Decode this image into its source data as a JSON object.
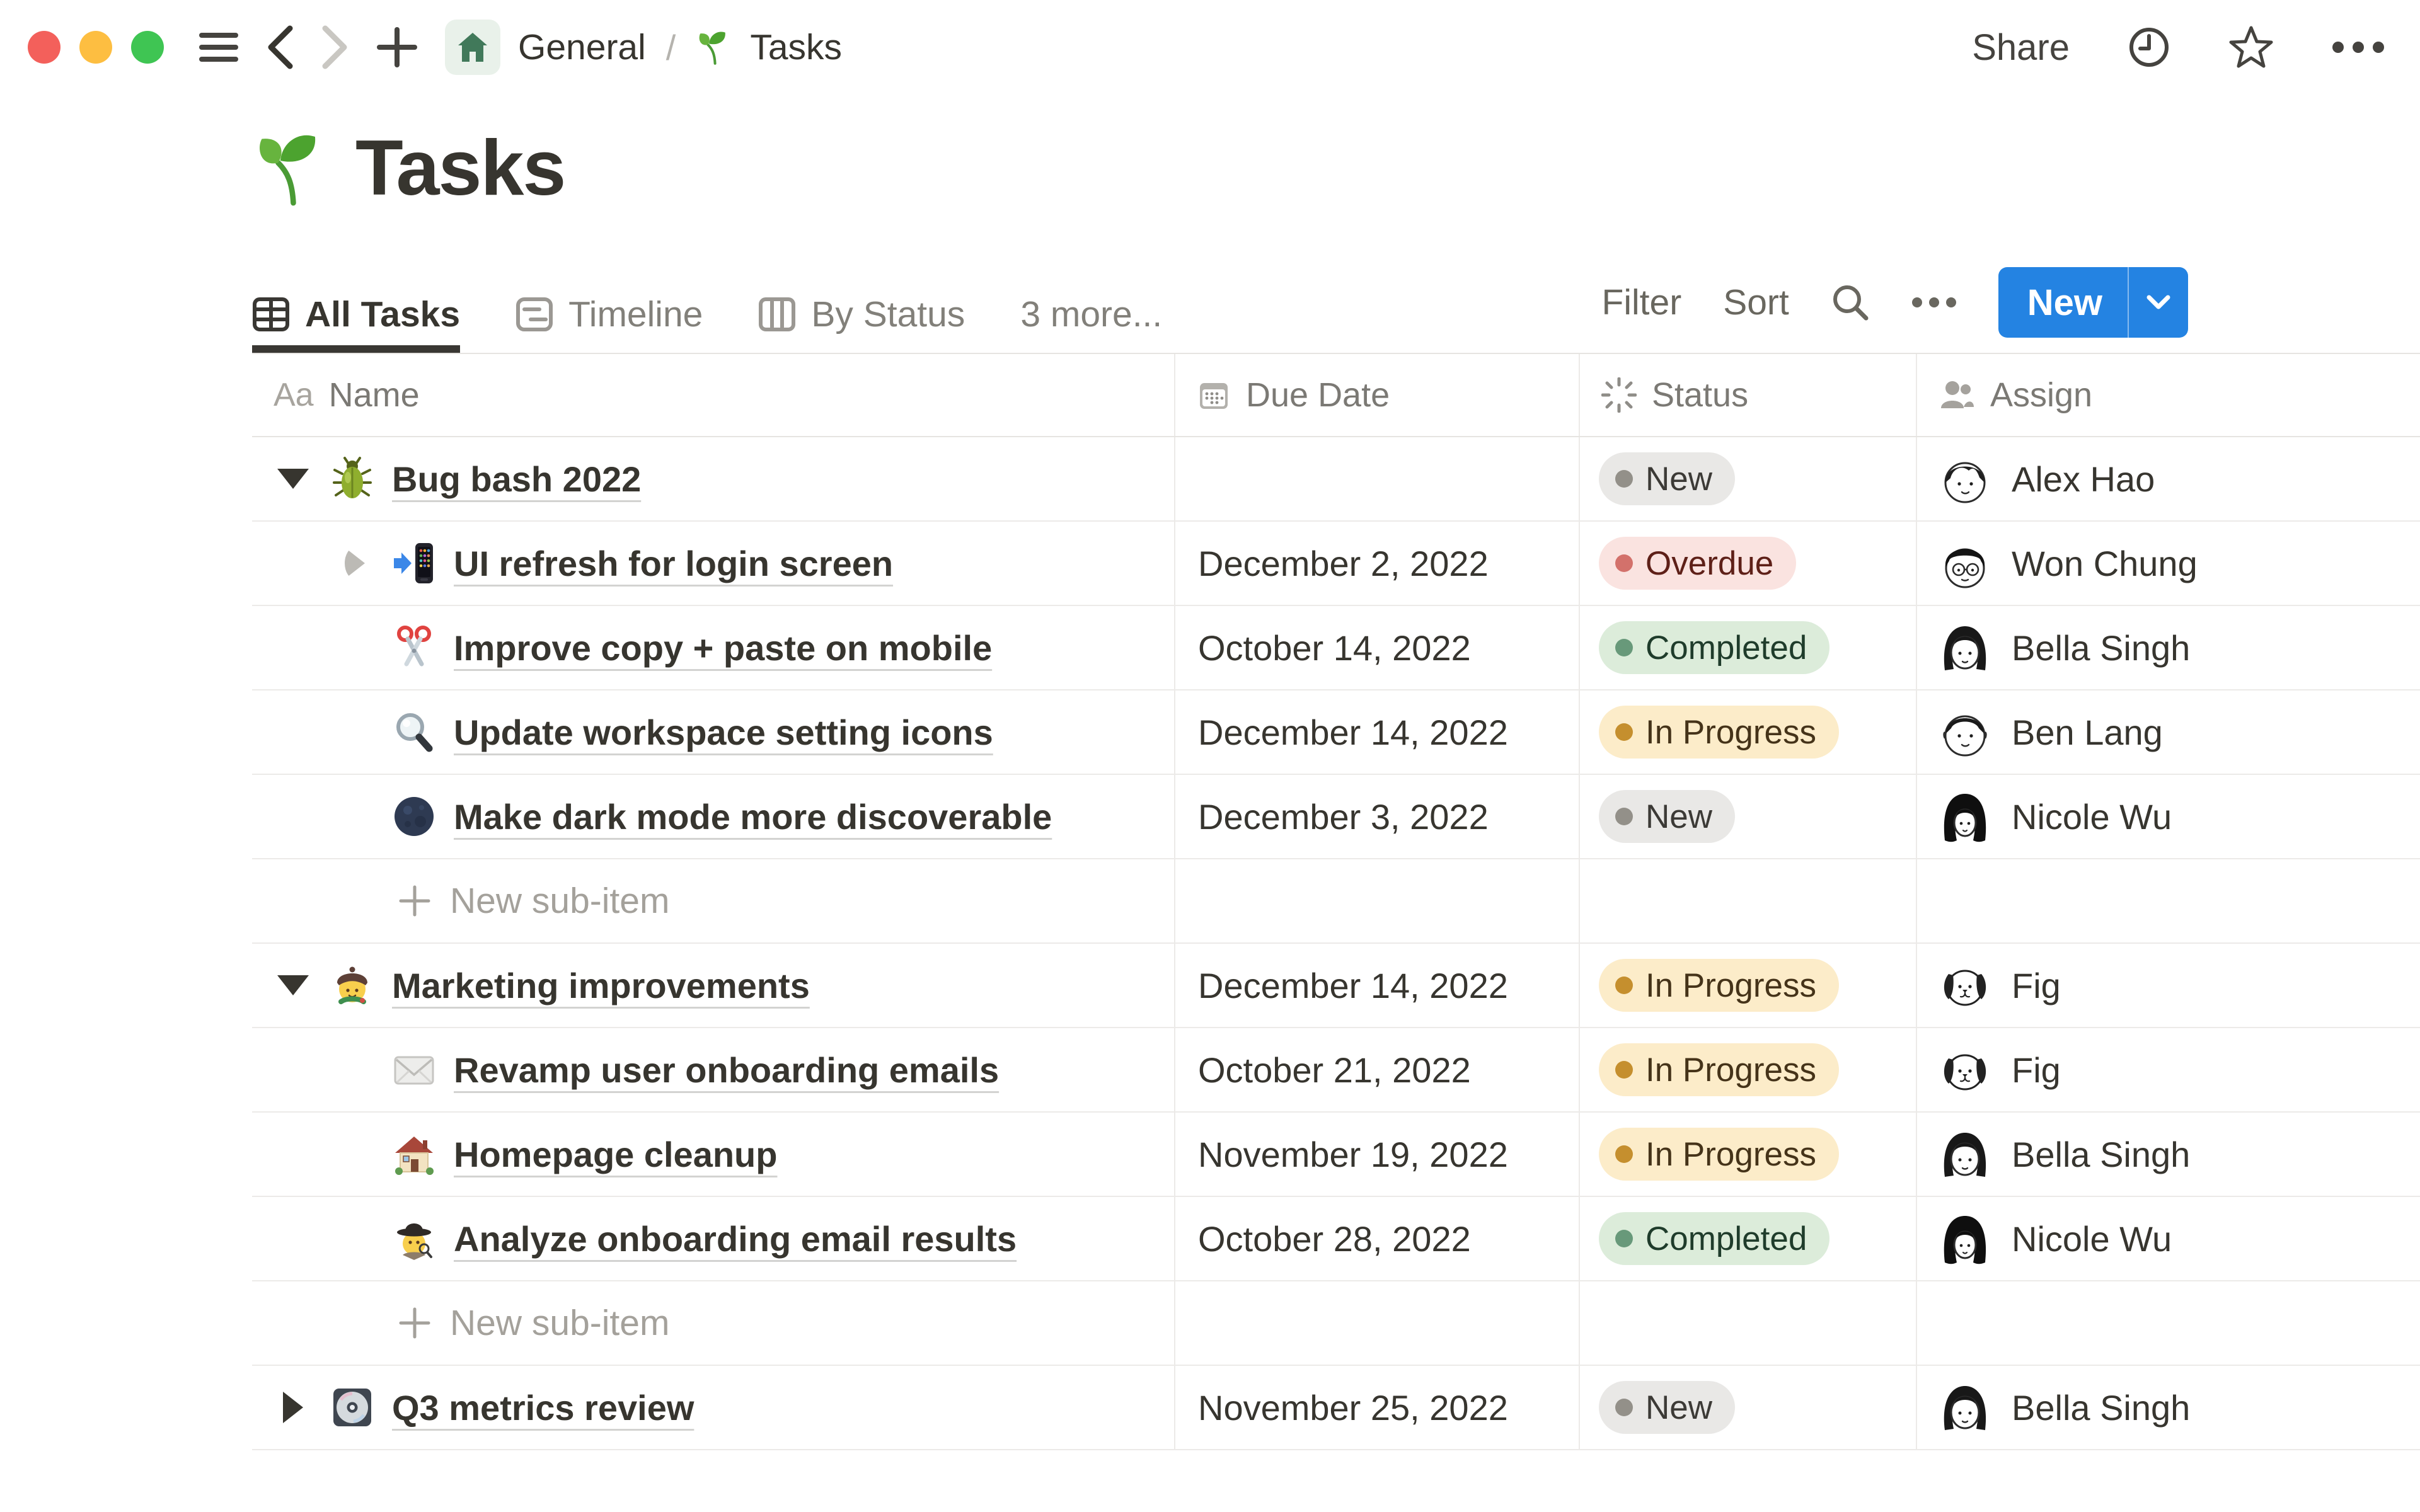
{
  "window": {
    "breadcrumb": {
      "root": "General",
      "separator": "/",
      "page": "Tasks"
    },
    "share_label": "Share"
  },
  "page": {
    "icon": "seedling-emoji",
    "title": "Tasks"
  },
  "view_tabs": {
    "tabs": [
      {
        "label": "All Tasks",
        "icon": "table-view-icon",
        "active": true
      },
      {
        "label": "Timeline",
        "icon": "timeline-view-icon",
        "active": false
      },
      {
        "label": "By Status",
        "icon": "board-view-icon",
        "active": false
      },
      {
        "label": "3 more...",
        "icon": "",
        "active": false
      }
    ]
  },
  "toolbar": {
    "filter_label": "Filter",
    "sort_label": "Sort",
    "new_label": "New"
  },
  "table": {
    "name_icon_text": "Aa",
    "columns": [
      {
        "label": "Name",
        "icon": "text-icon"
      },
      {
        "label": "Due Date",
        "icon": "calendar-icon"
      },
      {
        "label": "Status",
        "icon": "status-burst-icon"
      },
      {
        "label": "Assign",
        "icon": "people-icon"
      }
    ],
    "rows": [
      {
        "type": "task",
        "level": 0,
        "toggle": "expanded",
        "icon": "beetle-emoji",
        "title": "Bug bash 2022",
        "due": "",
        "status": {
          "label": "New",
          "variant": "new"
        },
        "assignee": {
          "name": "Alex Hao",
          "avatar": "alex-hao"
        }
      },
      {
        "type": "task",
        "level": 1,
        "toggle": "collapsed",
        "icon": "mobile-phone-arrow-emoji",
        "title": "UI refresh for login screen",
        "due": "December 2, 2022",
        "status": {
          "label": "Overdue",
          "variant": "overdue"
        },
        "assignee": {
          "name": "Won Chung",
          "avatar": "won-chung"
        }
      },
      {
        "type": "task",
        "level": 1,
        "toggle": "none",
        "icon": "scissors-emoji",
        "title": "Improve copy + paste on mobile",
        "due": "October 14, 2022",
        "status": {
          "label": "Completed",
          "variant": "completed"
        },
        "assignee": {
          "name": "Bella Singh",
          "avatar": "bella-singh"
        }
      },
      {
        "type": "task",
        "level": 1,
        "toggle": "none",
        "icon": "magnifying-glass-emoji",
        "title": "Update workspace setting icons",
        "due": "December 14, 2022",
        "status": {
          "label": "In Progress",
          "variant": "inprogress"
        },
        "assignee": {
          "name": "Ben Lang",
          "avatar": "ben-lang"
        }
      },
      {
        "type": "task",
        "level": 1,
        "toggle": "none",
        "icon": "new-moon-emoji",
        "title": "Make dark mode more discoverable",
        "due": "December 3, 2022",
        "status": {
          "label": "New",
          "variant": "new"
        },
        "assignee": {
          "name": "Nicole Wu",
          "avatar": "nicole-wu"
        }
      },
      {
        "type": "new-subitem",
        "label": "New sub-item"
      },
      {
        "type": "task",
        "level": 0,
        "toggle": "expanded",
        "icon": "artist-emoji",
        "title": "Marketing improvements",
        "due": "December 14, 2022",
        "status": {
          "label": "In Progress",
          "variant": "inprogress"
        },
        "assignee": {
          "name": "Fig",
          "avatar": "fig"
        }
      },
      {
        "type": "task",
        "level": 1,
        "toggle": "none",
        "icon": "envelope-emoji",
        "title": "Revamp user onboarding emails",
        "due": "October 21, 2022",
        "status": {
          "label": "In Progress",
          "variant": "inprogress"
        },
        "assignee": {
          "name": "Fig",
          "avatar": "fig"
        }
      },
      {
        "type": "task",
        "level": 1,
        "toggle": "none",
        "icon": "house-emoji",
        "title": "Homepage cleanup",
        "due": "November 19, 2022",
        "status": {
          "label": "In Progress",
          "variant": "inprogress"
        },
        "assignee": {
          "name": "Bella Singh",
          "avatar": "bella-singh"
        }
      },
      {
        "type": "task",
        "level": 1,
        "toggle": "none",
        "icon": "detective-emoji",
        "title": "Analyze onboarding email results",
        "due": "October 28, 2022",
        "status": {
          "label": "Completed",
          "variant": "completed"
        },
        "assignee": {
          "name": "Nicole Wu",
          "avatar": "nicole-wu"
        }
      },
      {
        "type": "new-subitem",
        "label": "New sub-item"
      },
      {
        "type": "task",
        "level": 0,
        "toggle": "collapsed-dark",
        "icon": "computer-disk-emoji",
        "title": "Q3 metrics review",
        "due": "November 25, 2022",
        "status": {
          "label": "New",
          "variant": "new"
        },
        "assignee": {
          "name": "Bella Singh",
          "avatar": "bella-singh"
        }
      }
    ]
  },
  "colors": {
    "accent_blue": "#2483e2",
    "text_primary": "#37352f",
    "text_gray": "#7b7974",
    "row_border": "#eceae8",
    "status_new_bg": "#e9e8e6",
    "status_new_dot": "#939089",
    "status_new_text": "#3c3a36",
    "status_overdue_bg": "#fae3e0",
    "status_overdue_dot": "#d3716b",
    "status_overdue_text": "#5e2018",
    "status_completed_bg": "#dcecda",
    "status_completed_dot": "#68997a",
    "status_completed_text": "#1f3c2b",
    "status_inprogress_bg": "#fcecc9",
    "status_inprogress_dot": "#c58f2e",
    "status_inprogress_text": "#453319",
    "traffic_red": "#f3605b",
    "traffic_yellow": "#fdbe41",
    "traffic_green": "#3fc553"
  }
}
